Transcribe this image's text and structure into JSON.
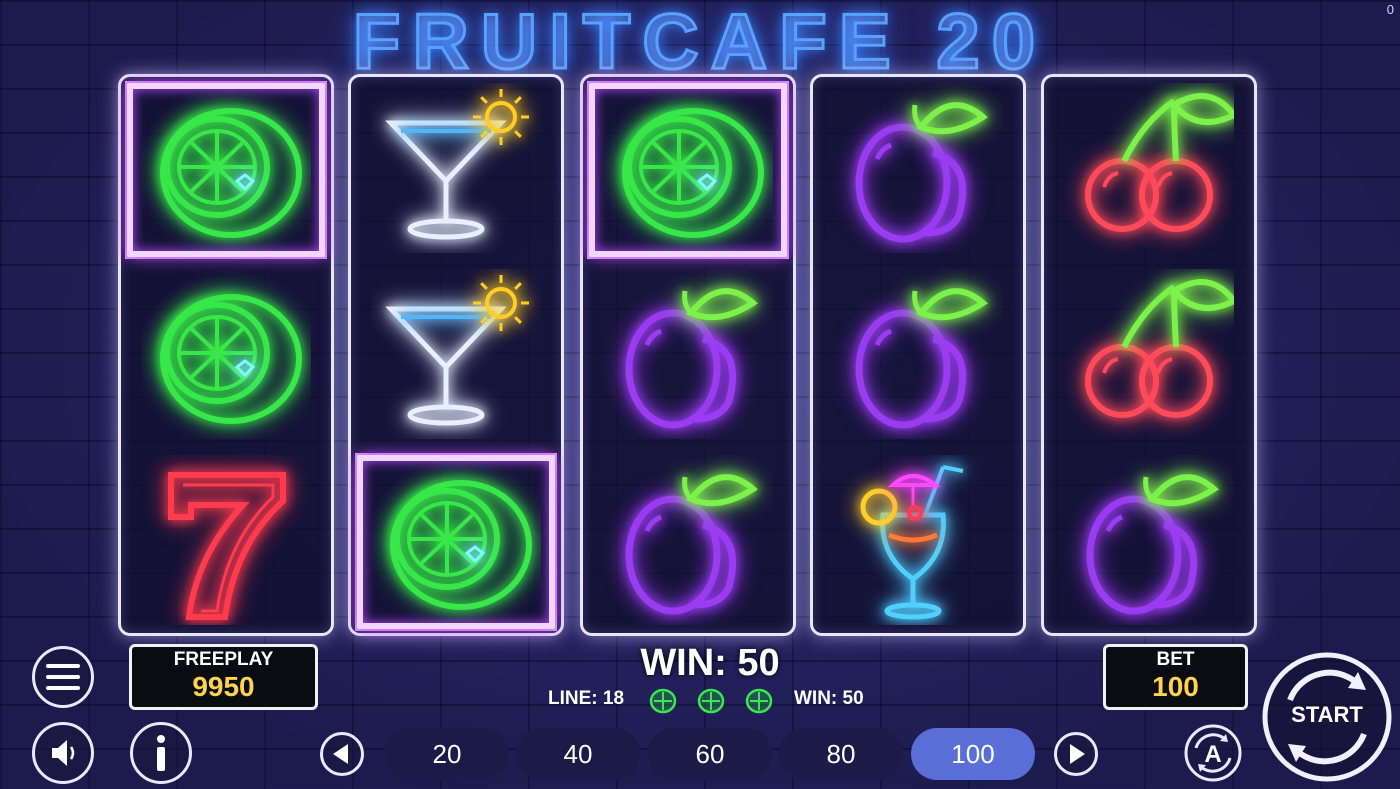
{
  "title": "FRUITCAFE 20",
  "corner_counter": "0",
  "reels": [
    [
      {
        "symbol": "lime",
        "win": true
      },
      {
        "symbol": "lime",
        "win": false
      },
      {
        "symbol": "seven",
        "win": false
      }
    ],
    [
      {
        "symbol": "martini",
        "win": false
      },
      {
        "symbol": "martini",
        "win": false
      },
      {
        "symbol": "lime",
        "win": true
      }
    ],
    [
      {
        "symbol": "lime",
        "win": true
      },
      {
        "symbol": "plum",
        "win": false
      },
      {
        "symbol": "plum",
        "win": false
      }
    ],
    [
      {
        "symbol": "plum",
        "win": false
      },
      {
        "symbol": "plum",
        "win": false
      },
      {
        "symbol": "cocktail",
        "win": false
      }
    ],
    [
      {
        "symbol": "cherry",
        "win": false
      },
      {
        "symbol": "cherry",
        "win": false
      },
      {
        "symbol": "plum",
        "win": false
      }
    ]
  ],
  "freeplay": {
    "label": "FREEPLAY",
    "value": "9950"
  },
  "bet": {
    "label": "BET",
    "value": "100"
  },
  "win_display": "WIN: 50",
  "line_info": {
    "line_text": "LINE: 18",
    "win_text": "WIN: 50",
    "symbol_count": 3
  },
  "bet_options": [
    "20",
    "40",
    "60",
    "80",
    "100"
  ],
  "selected_bet_index": 4,
  "buttons": {
    "start_label": "START",
    "autoplay_icon": "A"
  },
  "colors": {
    "lime": "#39e84a",
    "plum": "#9a3cf0",
    "cherry": "#ff4a5a",
    "leaf": "#7cf24a",
    "seven": "#ff3b4e",
    "glass": "#e6f0ff",
    "sun": "#ffcf2a",
    "win_frame": "#c04cff",
    "title": "#5aa0ff"
  }
}
